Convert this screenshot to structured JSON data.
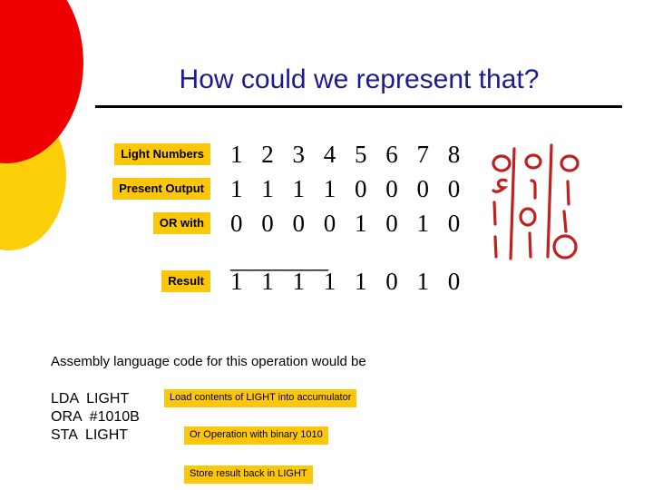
{
  "slide": {
    "title": "How could we represent that?",
    "colors": {
      "title": "#1b1b8f",
      "highlight": "#fcc70a",
      "deco_red": "#ee0000",
      "deco_yellow": "#fccf0a",
      "sketch_red": "#c02020"
    }
  },
  "table": {
    "rows": [
      {
        "label": "Light Numbers",
        "digits": "1 2 3 4 5 6 7 8"
      },
      {
        "label": "Present Output",
        "digits": "1 1 1 1 0 0 0 0"
      },
      {
        "label": "OR with",
        "digits": "0 0 0 0 1 0 1 0"
      }
    ],
    "divider": "________",
    "result": {
      "label": "Result",
      "digits": "1 1 1 1 1 0 1 0"
    }
  },
  "sketch": {
    "description": "hand-drawn red digits",
    "rows": [
      [
        "0",
        "0",
        "0"
      ],
      [
        "1",
        "1",
        "1"
      ],
      [
        "1",
        "0",
        "1"
      ],
      [
        "1",
        "1",
        "0"
      ]
    ]
  },
  "assembly": {
    "intro": "Assembly language code for this operation would be",
    "lines": [
      {
        "mnemonic": "LDA  LIGHT",
        "note": "Load contents of LIGHT into accumulator"
      },
      {
        "mnemonic": "ORA  #1010B",
        "note": "Or Operation with binary 1010"
      },
      {
        "mnemonic": "STA  LIGHT",
        "note": "Store result back in LIGHT"
      }
    ]
  }
}
